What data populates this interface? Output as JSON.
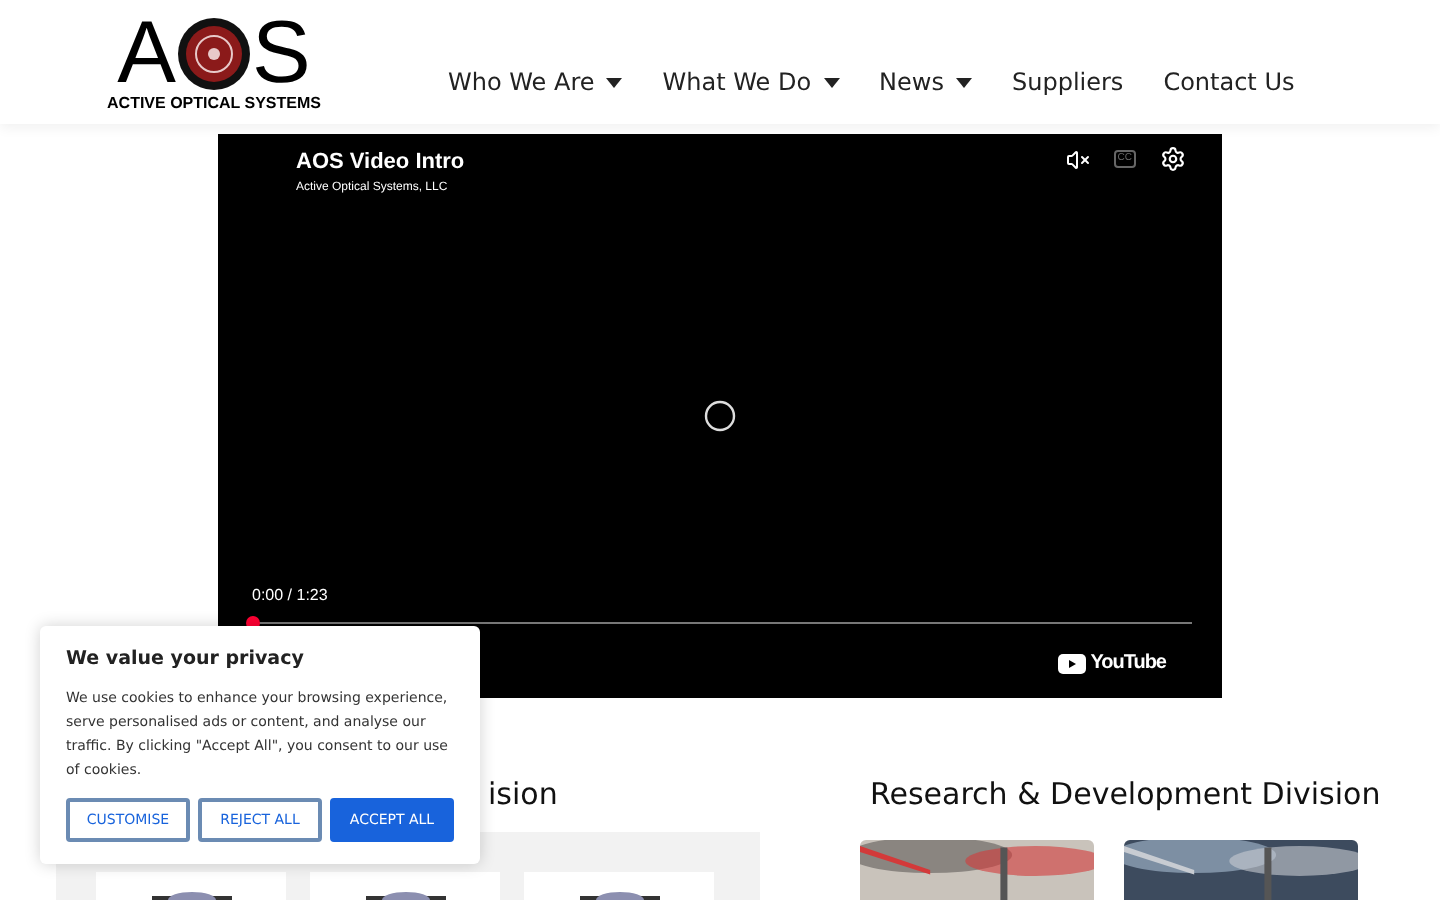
{
  "header": {
    "logo": {
      "letters": [
        "A",
        "S"
      ],
      "tagline": "ACTIVE OPTICAL SYSTEMS"
    },
    "nav": [
      {
        "label": "Who We Are",
        "dropdown": true
      },
      {
        "label": "What We Do",
        "dropdown": true
      },
      {
        "label": "News",
        "dropdown": true
      },
      {
        "label": "Suppliers",
        "dropdown": false
      },
      {
        "label": "Contact Us",
        "dropdown": false
      }
    ]
  },
  "video": {
    "title": "AOS Video Intro",
    "channel": "Active Optical Systems, LLC",
    "time": "0:00 / 1:23",
    "level": 0.0,
    "muted": true,
    "captions": "CC",
    "brand": "YouTube"
  },
  "sections": [
    {
      "heading": "ision"
    },
    {
      "heading": "Research & Development Division"
    }
  ],
  "cookie": {
    "title": "We value your privacy",
    "text": "We use cookies to enhance your browsing experience, serve personalised ads or content, and analyse our traffic. By clicking \"Accept All\", you consent to our use of cookies.",
    "buttons": [
      {
        "label": "CUSTOMISE",
        "primary": false
      },
      {
        "label": "REJECT ALL",
        "primary": false
      },
      {
        "label": "ACCEPT ALL",
        "primary": true
      }
    ]
  }
}
